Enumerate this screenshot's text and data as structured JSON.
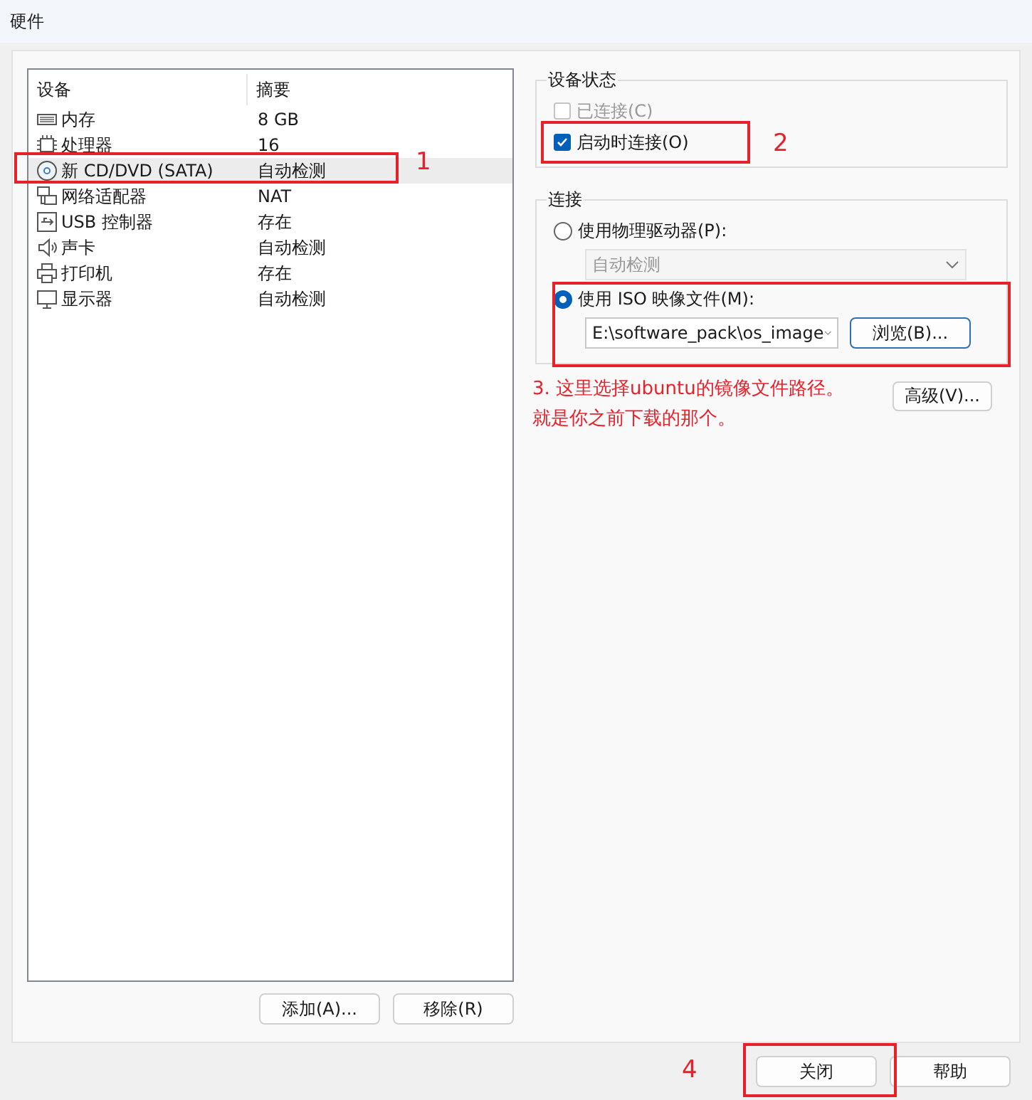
{
  "window": {
    "title": "硬件"
  },
  "device_list": {
    "columns": [
      "设备",
      "摘要"
    ],
    "rows": [
      {
        "kind": "memory",
        "device": "内存",
        "summary": "8 GB",
        "selected": false
      },
      {
        "kind": "cpu",
        "device": "处理器",
        "summary": "16",
        "selected": false
      },
      {
        "kind": "cd",
        "device": "新 CD/DVD (SATA)",
        "summary": "自动检测",
        "selected": true
      },
      {
        "kind": "network",
        "device": "网络适配器",
        "summary": "NAT",
        "selected": false
      },
      {
        "kind": "usb",
        "device": "USB 控制器",
        "summary": "存在",
        "selected": false
      },
      {
        "kind": "sound",
        "device": "声卡",
        "summary": "自动检测",
        "selected": false
      },
      {
        "kind": "printer",
        "device": "打印机",
        "summary": "存在",
        "selected": false
      },
      {
        "kind": "display",
        "device": "显示器",
        "summary": "自动检测",
        "selected": false
      }
    ],
    "buttons": [
      "添加(A)...",
      "移除(R)"
    ]
  },
  "device_status": {
    "title": "设备状态",
    "options": [
      {
        "label": "已连接(C)",
        "checked": false,
        "disabled": true
      },
      {
        "label": "启动时连接(O)",
        "checked": true,
        "disabled": false
      }
    ]
  },
  "connection": {
    "title": "连接",
    "options": [
      {
        "label": "使用物理驱动器(P):",
        "selected": false,
        "dropdown": {
          "value": "自动检测",
          "disabled": true
        }
      },
      {
        "label": "使用 ISO 映像文件(M):",
        "selected": true,
        "dropdown": {
          "value": "E:\\software_pack\\os_image",
          "disabled": false
        },
        "button": "浏览(B)..."
      }
    ]
  },
  "advanced_button": "高级(V)...",
  "footer_buttons": [
    "关闭",
    "帮助"
  ],
  "annotations": {
    "markers": [
      "1",
      "2",
      "4"
    ],
    "note_lines": [
      "3. 这里选择ubuntu的镜像文件路径。",
      "就是你之前下载的那个。"
    ]
  }
}
